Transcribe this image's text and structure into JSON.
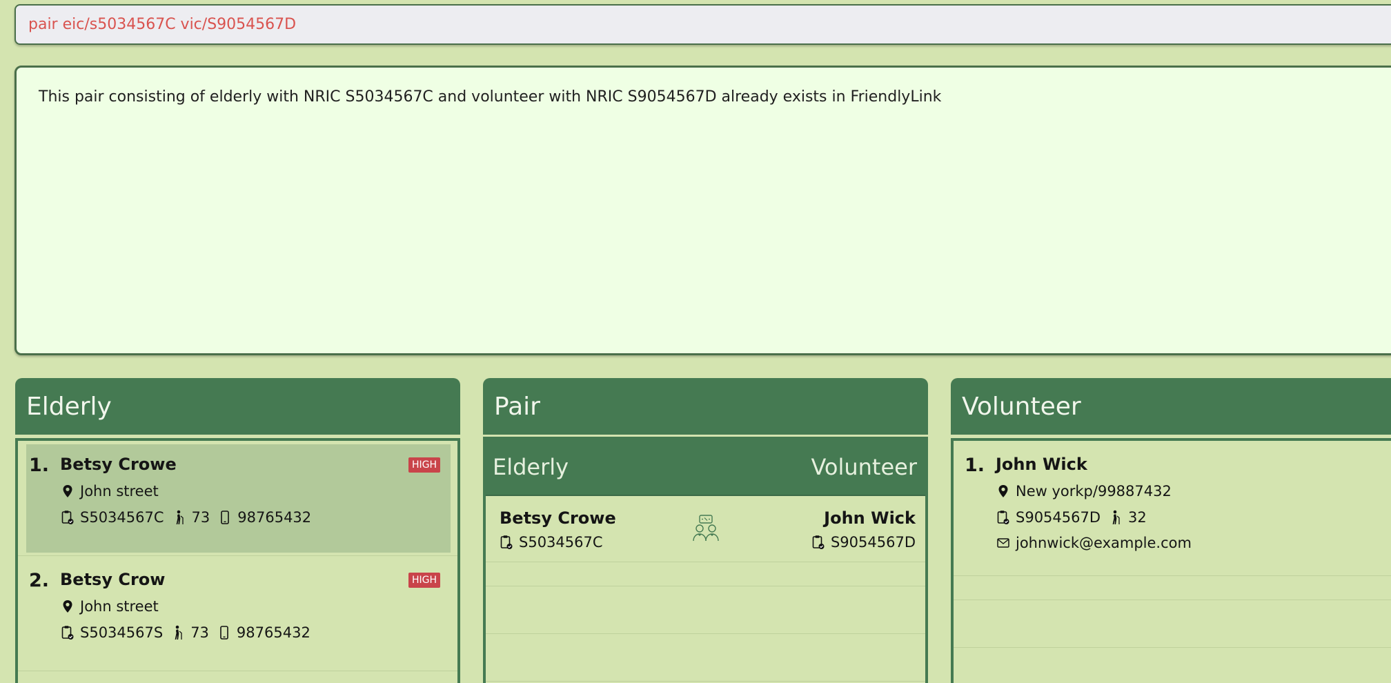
{
  "command": {
    "value": "pair eic/s5034567C vic/S9054567D"
  },
  "result": {
    "message": "This pair consisting of elderly with NRIC S5034567C and volunteer with NRIC S9054567D already exists in FriendlyLink"
  },
  "elderly_panel": {
    "title": "Elderly",
    "items": [
      {
        "index": "1.",
        "name": "Betsy Crowe",
        "risk": "HIGH",
        "address": "John street",
        "nric": "S5034567C",
        "age": "73",
        "phone": "98765432",
        "selected": true
      },
      {
        "index": "2.",
        "name": "Betsy Crow",
        "risk": "HIGH",
        "address": "John street",
        "nric": "S5034567S",
        "age": "73",
        "phone": "98765432",
        "selected": false
      }
    ]
  },
  "pair_panel": {
    "title": "Pair",
    "col_elderly": "Elderly",
    "col_volunteer": "Volunteer",
    "pairs": [
      {
        "elderly_name": "Betsy Crowe",
        "elderly_nric": "S5034567C",
        "volunteer_name": "John Wick",
        "volunteer_nric": "S9054567D"
      }
    ]
  },
  "volunteer_panel": {
    "title": "Volunteer",
    "items": [
      {
        "index": "1.",
        "name": "John Wick",
        "address": "New yorkp/99887432",
        "nric": "S9054567D",
        "age": "32",
        "email": "johnwick@example.com"
      }
    ]
  },
  "colors": {
    "header_green": "#457a52",
    "background": "#d4e4b0",
    "result_bg": "#efffe4",
    "command_text": "#d9534f",
    "high_badge": "#c9444a"
  }
}
